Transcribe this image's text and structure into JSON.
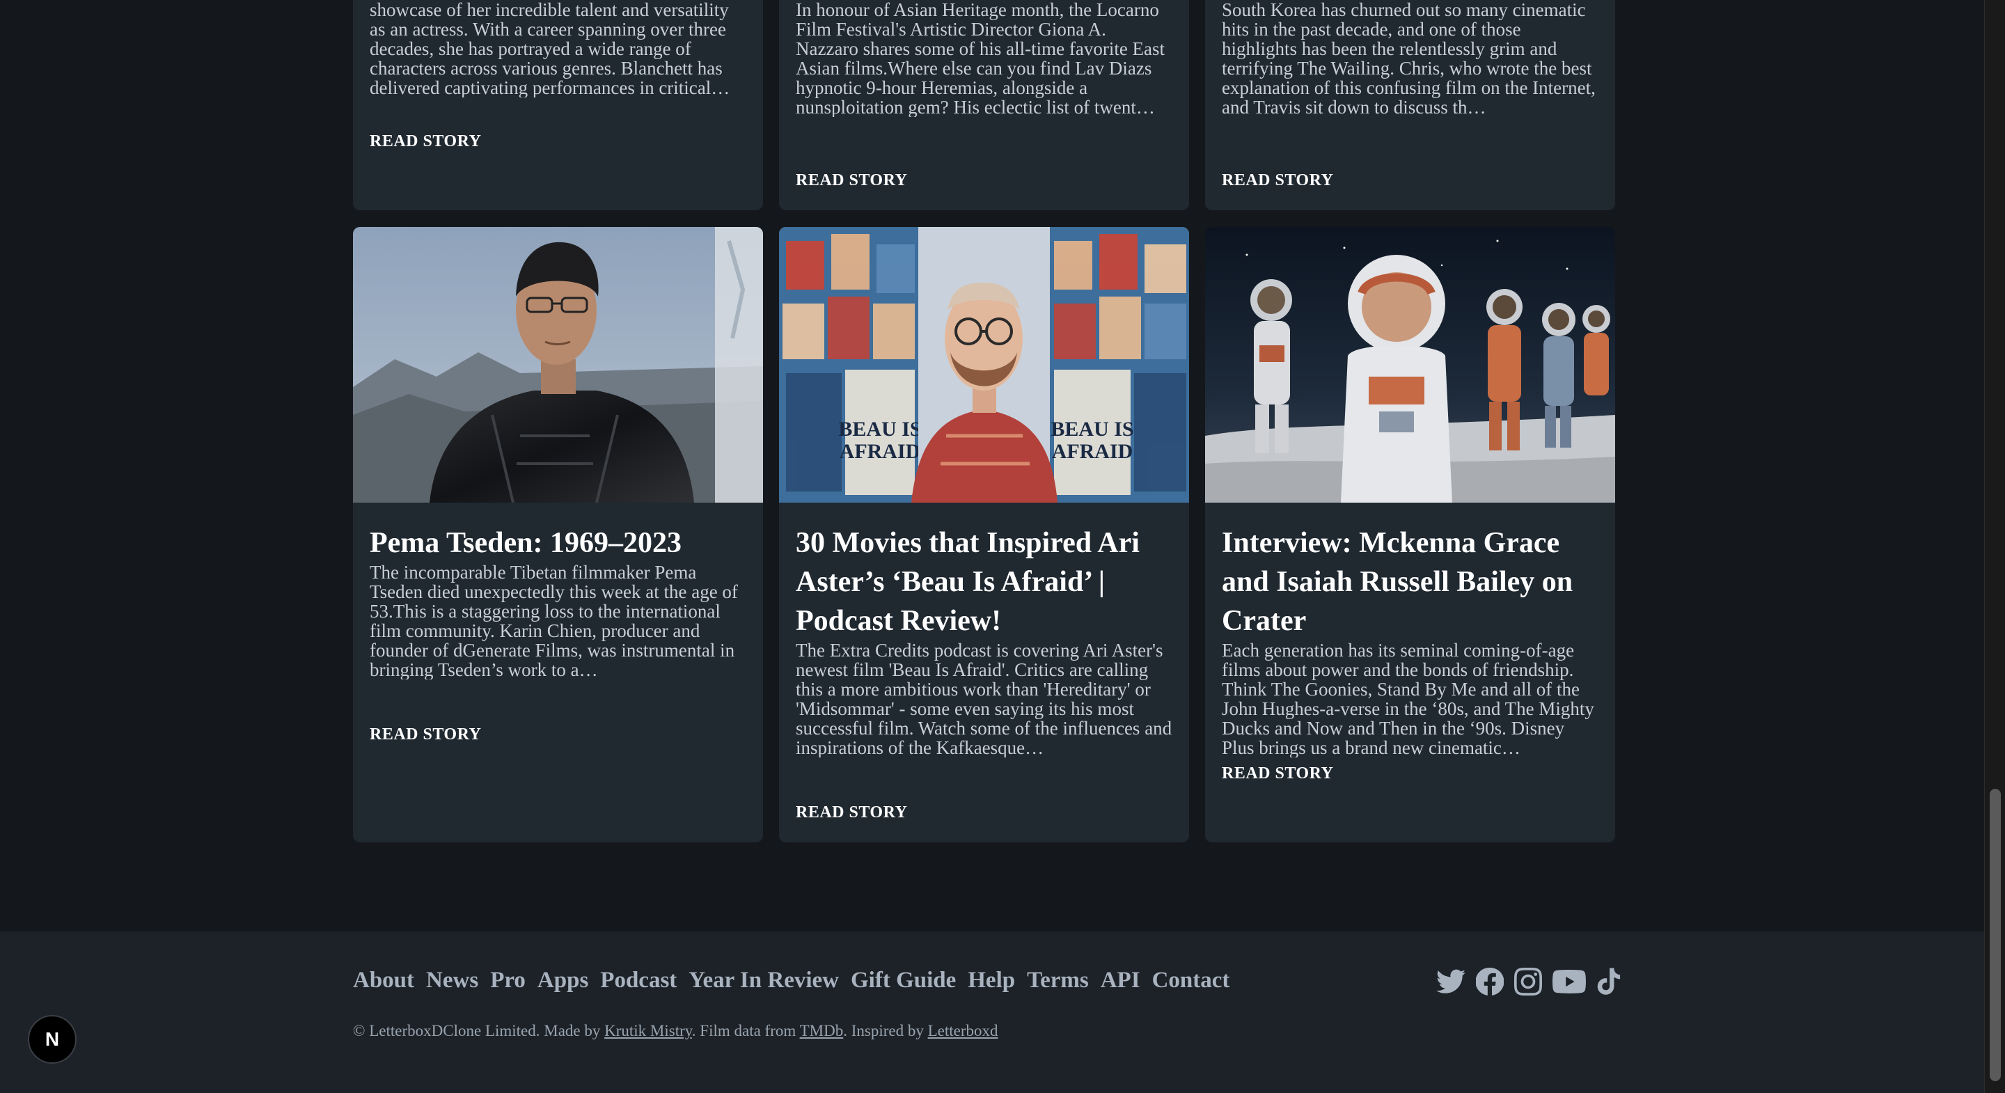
{
  "top_cards": [
    {
      "description": "showcase of her incredible talent and versatility as an actress. With a career spanning over three decades, she has portrayed a wide range of characters across various genres. Blanchett has delivered captivating performances in critical…",
      "read_label": "READ STORY"
    },
    {
      "description": "In honour of Asian Heritage month, the Locarno Film Festival's Artistic Director Giona A. Nazzaro shares some of his all-time favorite East Asian films.Where else can you find Lav Diazs hypnotic 9-hour Heremias, alongside a nunsploitation gem? His eclectic list of twent…",
      "read_label": "READ STORY"
    },
    {
      "description": "South Korea has churned out so many cinematic hits in the past decade, and one of those highlights has been the relentlessly grim and terrifying The Wailing. Chris, who wrote the best explanation of this confusing film on the Internet, and Travis sit down to discuss th…",
      "read_label": "READ STORY"
    }
  ],
  "cards": [
    {
      "title": "Pema Tseden: 1969–2023",
      "description": "The incomparable Tibetan filmmaker Pema Tseden died unexpectedly this week at the age of 53.This is a staggering loss to the international film community. Karin Chien, producer and founder of dGenerate Films, was instrumental in bringing Tseden’s work to a…",
      "read_label": "READ STORY"
    },
    {
      "title": "30 Movies that Inspired Ari Aster’s ‘Beau Is Afraid’ | Podcast Review!",
      "description": "The Extra Credits podcast is covering Ari Aster's newest film 'Beau Is Afraid'. Critics are calling this a more ambitious work than 'Hereditary' or 'Midsommar' - some even saying its his most successful film. Watch some of the influences and inspirations of the Kafkaesque…",
      "read_label": "READ STORY",
      "poster_text": "BEAU IS AFRAID"
    },
    {
      "title": "Interview: Mckenna Grace and Isaiah Russell Bailey on Crater",
      "description": "Each generation has its seminal coming-of-age films about power and the bonds of friendship. Think The Goonies, Stand By Me and all of the John Hughes-a-verse in the ‘80s, and The Mighty Ducks and Now and Then in the ‘90s. Disney Plus brings us a brand new cinematic…",
      "read_label": "READ STORY"
    }
  ],
  "footer": {
    "nav": [
      "About",
      "News",
      "Pro",
      "Apps",
      "Podcast",
      "Year In Review",
      "Gift Guide",
      "Help",
      "Terms",
      "API",
      "Contact"
    ],
    "copyright_prefix": "© LetterboxDClone Limited. Made by ",
    "author": "Krutik Mistry",
    "mid1": ". Film data from ",
    "tmdb": "TMDb",
    "mid2": ". Inspired by ",
    "letterboxd": "Letterboxd",
    "social_icons": [
      "twitter-icon",
      "facebook-icon",
      "instagram-icon",
      "youtube-icon",
      "tiktok-icon"
    ]
  },
  "badge": {
    "letter": "N"
  },
  "colors": {
    "background": "#14181c",
    "card": "#202830",
    "footer": "#1c2228",
    "muted_text": "#a9b3bf"
  }
}
